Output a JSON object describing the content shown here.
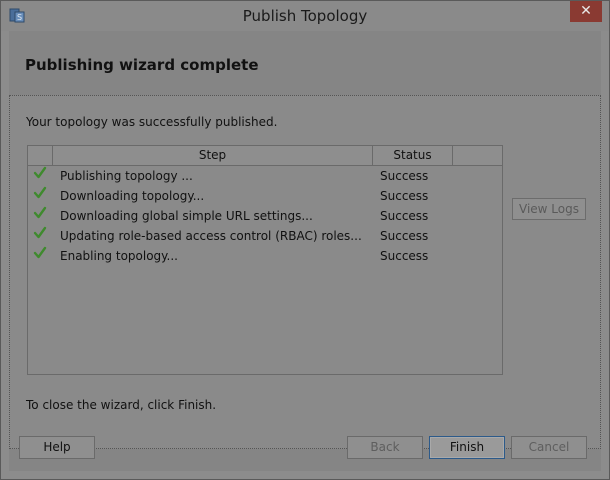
{
  "window": {
    "title": "Publish Topology",
    "close_glyph": "✕"
  },
  "header": {
    "title": "Publishing wizard complete"
  },
  "content": {
    "success_message": "Your topology was successfully published.",
    "close_hint": "To close the wizard, click Finish."
  },
  "grid": {
    "columns": [
      "Step",
      "Status"
    ],
    "rows": [
      {
        "step": "Publishing topology ...",
        "status": "Success",
        "icon": "check-icon"
      },
      {
        "step": "Downloading topology...",
        "status": "Success",
        "icon": "check-icon"
      },
      {
        "step": "Downloading global simple URL settings...",
        "status": "Success",
        "icon": "check-icon"
      },
      {
        "step": "Updating role-based access control (RBAC) roles...",
        "status": "Success",
        "icon": "check-icon"
      },
      {
        "step": "Enabling topology...",
        "status": "Success",
        "icon": "check-icon"
      }
    ]
  },
  "buttons": {
    "view_logs": "View Logs",
    "help": "Help",
    "back": "Back",
    "finish": "Finish",
    "cancel": "Cancel"
  },
  "colors": {
    "check": "#3f8a2e",
    "close_button": "#8a3a32"
  }
}
